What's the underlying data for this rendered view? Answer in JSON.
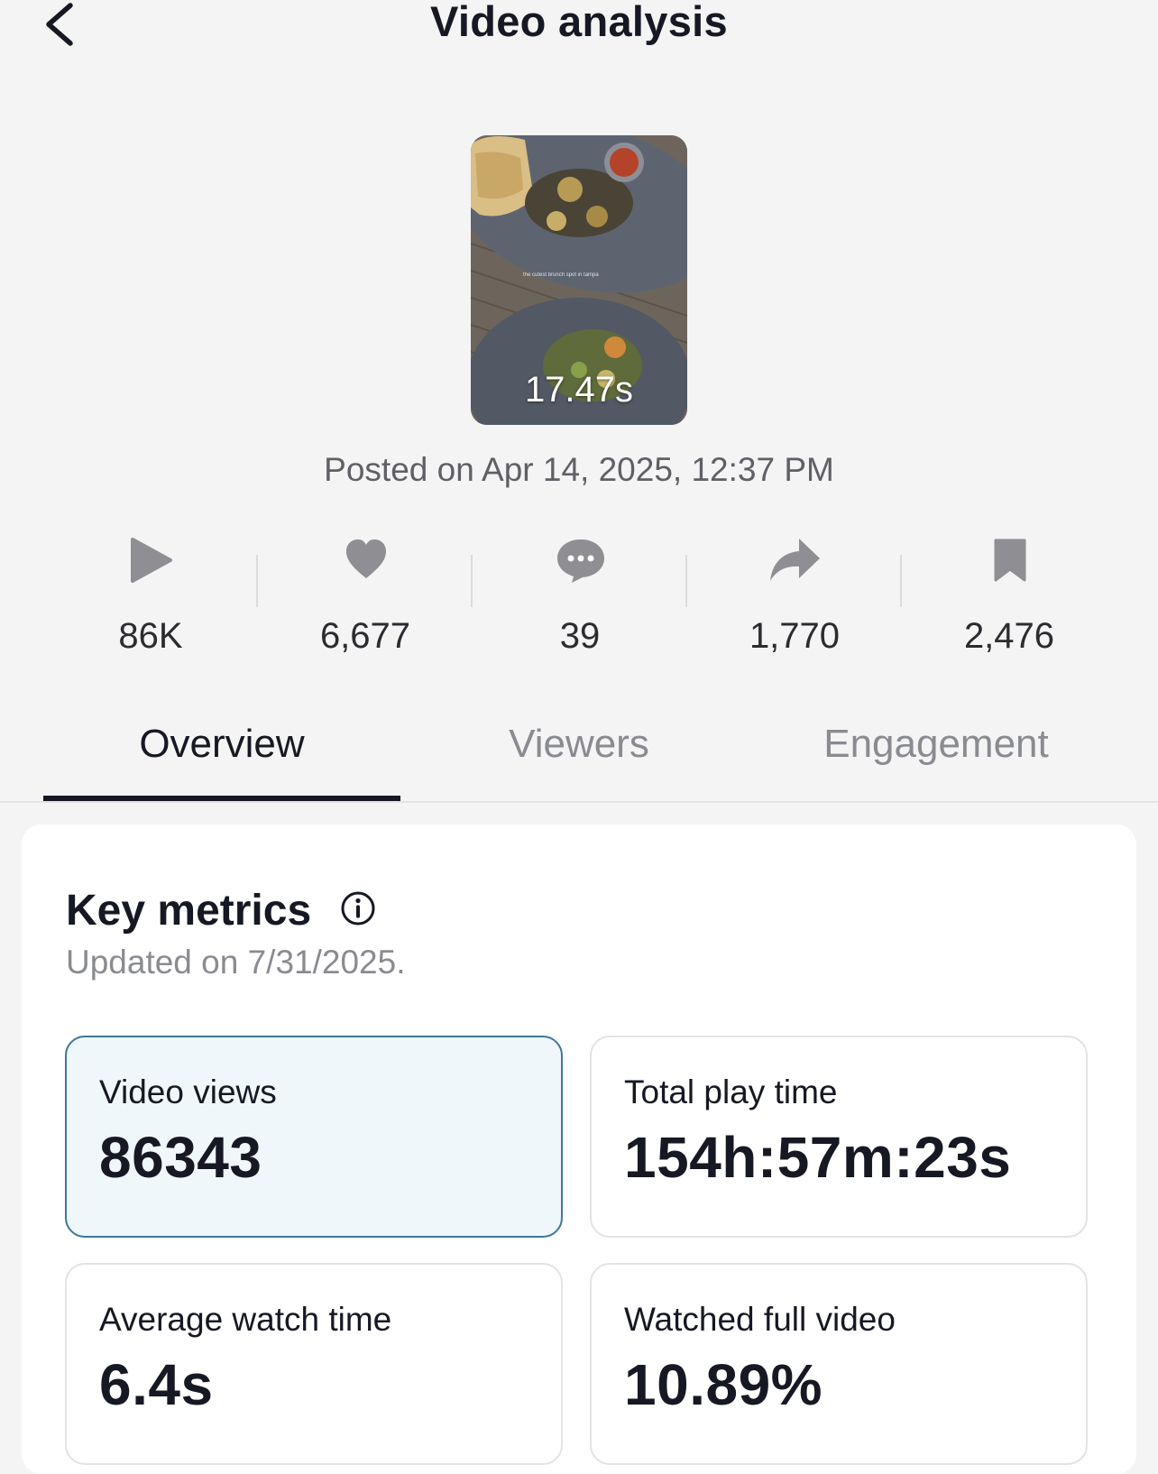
{
  "header": {
    "title": "Video analysis",
    "back_icon": "chevron-left-icon"
  },
  "video": {
    "duration": "17.47s",
    "overlay_caption": "the cutest brunch spot in tampa",
    "posted": "Posted on Apr 14, 2025, 12:37 PM"
  },
  "stats": [
    {
      "icon": "play-icon",
      "value": "86K"
    },
    {
      "icon": "heart-icon",
      "value": "6,677"
    },
    {
      "icon": "comment-icon",
      "value": "39"
    },
    {
      "icon": "share-icon",
      "value": "1,770"
    },
    {
      "icon": "bookmark-icon",
      "value": "2,476"
    }
  ],
  "tabs": [
    {
      "label": "Overview",
      "active": true
    },
    {
      "label": "Viewers",
      "active": false
    },
    {
      "label": "Engagement",
      "active": false
    }
  ],
  "key_metrics": {
    "title": "Key metrics",
    "info_icon": "info-icon",
    "updated": "Updated on 7/31/2025.",
    "metrics": [
      {
        "label": "Video views",
        "value": "86343",
        "selected": true
      },
      {
        "label": "Total play time",
        "value": "154h:57m:23s",
        "selected": false
      },
      {
        "label": "Average watch time",
        "value": "6.4s",
        "selected": false
      },
      {
        "label": "Watched full video",
        "value": "10.89%",
        "selected": false
      }
    ]
  },
  "colors": {
    "background": "#f4f4f4",
    "text_primary": "#161823",
    "text_secondary": "#8a8b91",
    "icon_gray": "#8e8e93",
    "selected_card_bg": "#f0f7fb",
    "selected_card_border": "#3c7898"
  }
}
